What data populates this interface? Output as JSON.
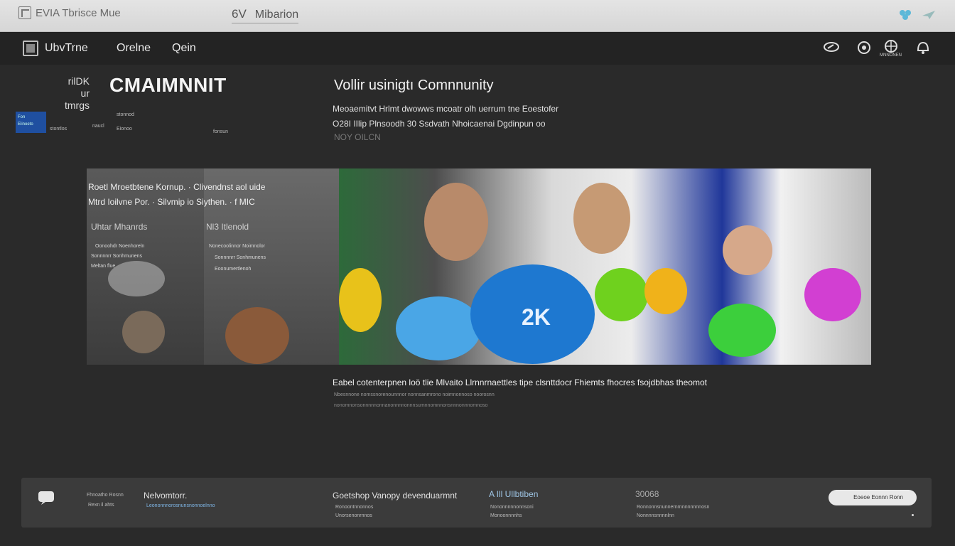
{
  "topbar": {
    "brand": "EVIA Tbrisce Mue",
    "center_a": "6V",
    "center_b": "Mibarion"
  },
  "nav": {
    "items": [
      "UbvTrne",
      "Orelne",
      "Qein"
    ],
    "icon_caption": "MNNONEN"
  },
  "hero": {
    "small_lines": [
      "rilDK",
      "ur tmrgs"
    ],
    "title": "CMAIMNNIT",
    "bluebox_text": [
      "Fon",
      "Elinoeto"
    ],
    "tiny_labels": [
      "stonnod",
      "stontlos",
      "naucl",
      "Eionoo",
      "fonsun"
    ],
    "headline": "Vollir usinigtı Comnnunity",
    "desc_line1": "Meoaemitvt Hrlmt dwowws mcoatr olh uerrum tne Eoestofer",
    "desc_line2": "O28I IIlip Plnsoodh 30 Ssdvath Nhoicaenai Dgdinpun oo",
    "desc_line3": "NOY OILCN"
  },
  "banner": {
    "line1": "Roetl Mroetbtene Kornup.  ·  Clivendnst aol uide",
    "line2": "Mtrd Ioilvne  Por.  ·  Silvmip io Siythen.  ·  f MIC",
    "left_head": "Uhtar Mhanrds",
    "left_items": [
      "Oonoohdr Noenhoreln",
      "Sonnnnrr Sonhmunens",
      "Meltan flue"
    ],
    "mid_head": "Nl3 Itlenold",
    "mid_items": [
      "Nonecoolinnor Noimnolor",
      "Sonnnnrr Sonhmunens",
      "Eoonumertlenoh"
    ],
    "badge": "2K"
  },
  "caption": {
    "main": "Eabel cotenterpnen loö tlie Mlvaito Llrnnrnaettles tipe clsnttdocr Fhiemts fhocres fsojdbhas theomot",
    "sub1": "Nbesnnone nomssnorenounnnor nonnsanmrono noimnonnoso noorosnn",
    "sub2": "nonomnonsonnnnnonnanonnnnonnnsumnnomnnonsnnnonnnomnoso"
  },
  "footer": {
    "col1_small": [
      "Fhnoatho Rosnn",
      "Rexn il ahts"
    ],
    "col2_title": "Nelvomtorr.",
    "col2_sub": "Leononnnorosnunsnonnoelnno",
    "col3_title": "Goetshop Vanopy devenduarmnt",
    "col3_sub": [
      "Ronoontnnonnos",
      "Unorsenonrnnos"
    ],
    "col4_title": "A  Ill   Ullbtiben",
    "col4_sub": [
      "Nononnnnnonnsoni",
      "Monoonnnnhs"
    ],
    "col5_title": "30068",
    "col5_sub": [
      "Ronnonnsnunnernrnnnnnnnnosn",
      "Nonnnnsnnnnlnn"
    ],
    "button": "Eoeoe  Eonnn  Ronn"
  },
  "colors": {
    "page_bg": "#2a2a2a",
    "topbar_bg": "#dddddd",
    "nav_bg": "#232323",
    "accent_blue": "#1f4fa0",
    "bubble_blue": "#1e78d0",
    "bubble_green": "#3ccf3c",
    "bubble_yellow": "#e8c21a",
    "bubble_pink": "#d23fd2"
  }
}
